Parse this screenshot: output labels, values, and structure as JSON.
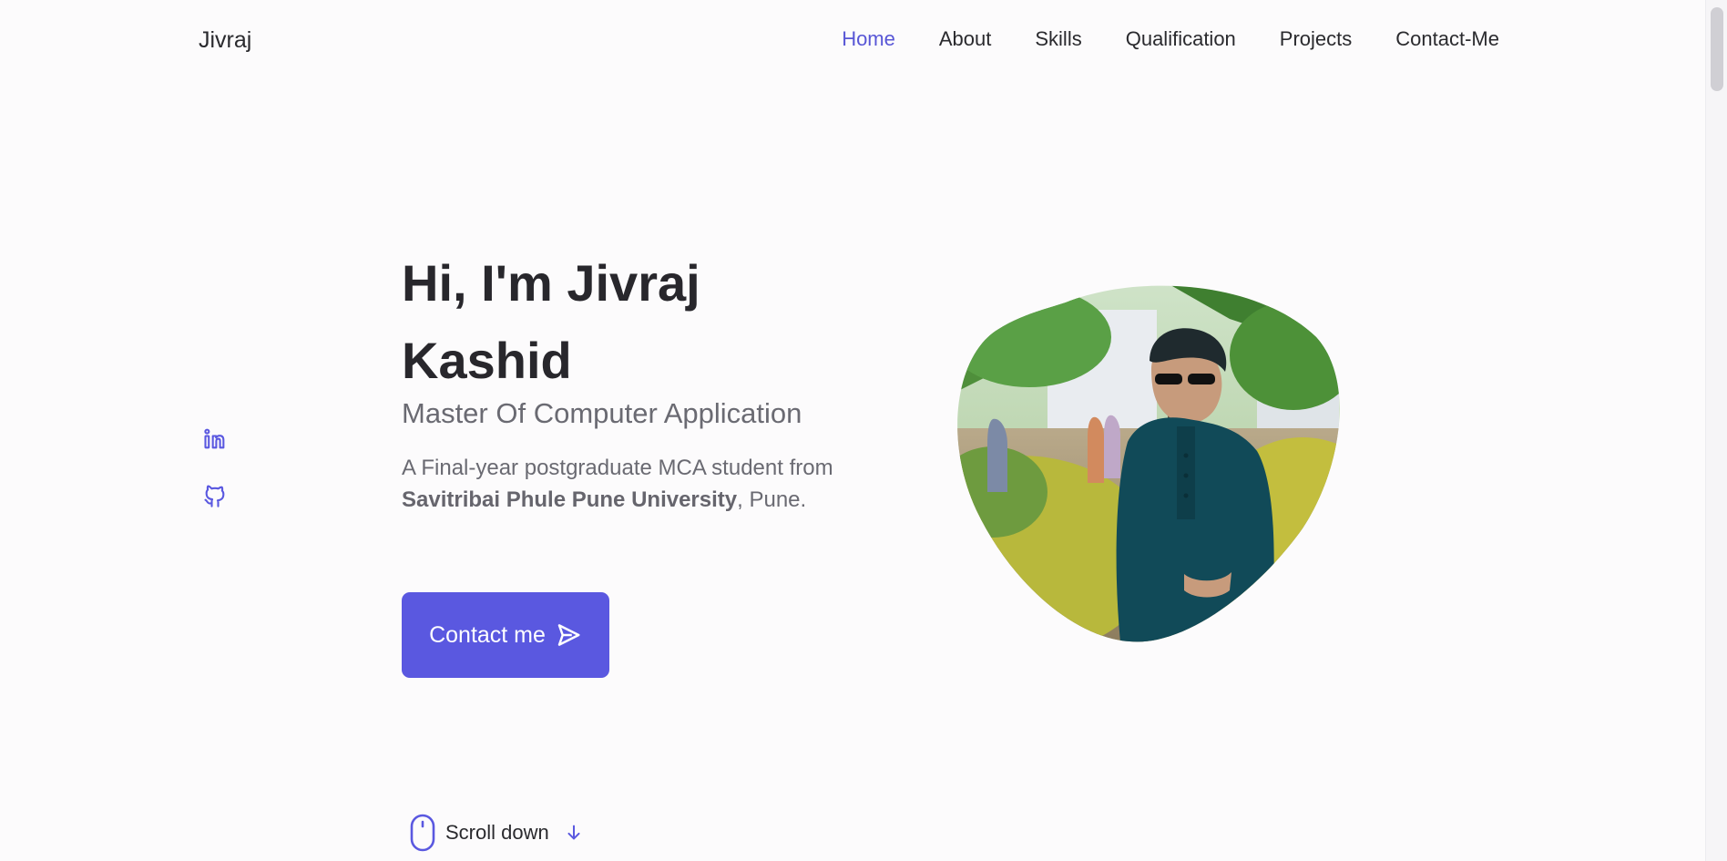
{
  "header": {
    "logo": "Jivraj",
    "nav": [
      {
        "label": "Home"
      },
      {
        "label": "About"
      },
      {
        "label": "Skills"
      },
      {
        "label": "Qualification"
      },
      {
        "label": "Projects"
      },
      {
        "label": "Contact-Me"
      }
    ],
    "active_nav": "Home"
  },
  "social": {
    "icons": [
      "linkedin-icon",
      "github-icon"
    ]
  },
  "hero": {
    "title_line1": "Hi, I'm Jivraj",
    "title_line2": "Kashid",
    "subtitle": "Master Of Computer Application",
    "desc_prefix": "A Final-year postgraduate MCA student from ",
    "desc_bold": "Savitribai Phule Pune University",
    "desc_suffix": ", Pune.",
    "button_label": "Contact me",
    "button_icon": "send-icon"
  },
  "scroll": {
    "label": "Scroll down",
    "mouse_icon": "mouse-icon",
    "arrow_icon": "arrow-down-icon"
  },
  "colors": {
    "accent": "#5a58e0",
    "background": "#fcfbfc",
    "text": "#2a2a2e",
    "muted": "#6a6a72"
  }
}
